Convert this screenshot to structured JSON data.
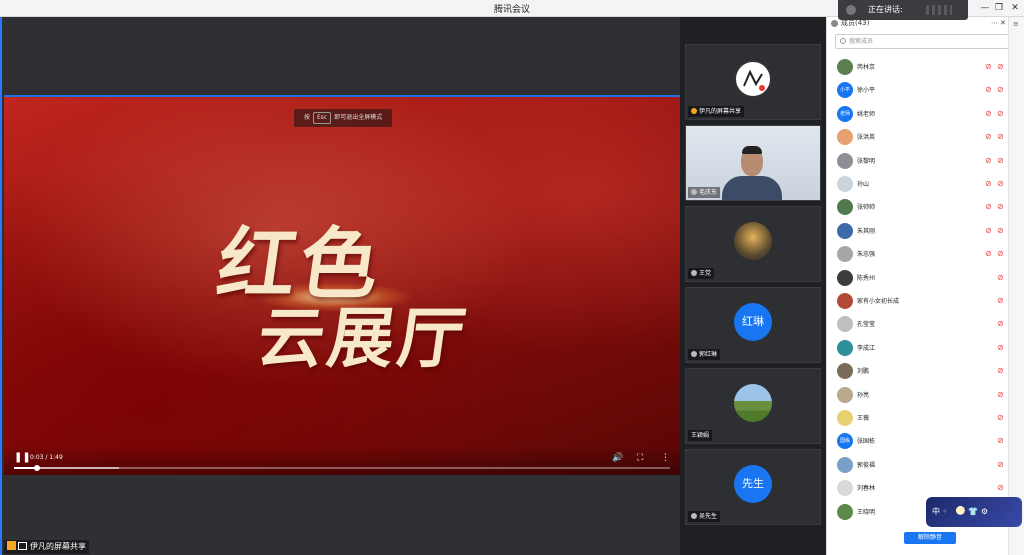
{
  "window": {
    "title": "腾讯会议"
  },
  "speaking": {
    "label": "正在讲话:"
  },
  "video": {
    "title_line1": "红色",
    "title_line2": "云展厅",
    "esc_prefix": "按",
    "esc_key": "Esc",
    "esc_suffix": "即可退出全屏模式",
    "time": "0:03 / 1:49",
    "progress": 0.035,
    "buffered": 0.16
  },
  "share": {
    "label": "伊凡的屏幕共享"
  },
  "tiles": [
    {
      "name": "伊凡的屏幕共享",
      "type": "avatar-logo"
    },
    {
      "name": "毛庆东",
      "type": "camera"
    },
    {
      "name": "王党",
      "type": "avatar-photo"
    },
    {
      "name": "郭红琳",
      "type": "avatar-text",
      "avatar_text": "红琳"
    },
    {
      "name": "王颖娟",
      "type": "avatar-landscape"
    },
    {
      "name": "吴先生",
      "type": "avatar-text",
      "avatar_text": "先生"
    }
  ],
  "members_panel": {
    "title": "成员(43)",
    "search_placeholder": "搜索成员",
    "unmute_all_label": "解除静音",
    "members": [
      {
        "name": "芮林京",
        "avatar_color": "#5b7f4f"
      },
      {
        "name": "徐小平",
        "avatar_color": "#1876f2",
        "avatar_text": "小平"
      },
      {
        "name": "姚老师",
        "avatar_color": "#1876f2",
        "avatar_text": "老师"
      },
      {
        "name": "张洪英",
        "avatar_color": "#e8a070"
      },
      {
        "name": "张黎明",
        "avatar_color": "#8e8e94"
      },
      {
        "name": "孙山",
        "avatar_color": "#c9d4dc"
      },
      {
        "name": "张帅帅",
        "avatar_color": "#507a4e"
      },
      {
        "name": "朱其刚",
        "avatar_color": "#3d6aa8"
      },
      {
        "name": "朱忠强",
        "avatar_color": "#a6a6a6"
      },
      {
        "name": "陈秀州",
        "avatar_color": "#3d3d3d"
      },
      {
        "name": "家有小女初长成",
        "avatar_color": "#b24a3a"
      },
      {
        "name": "孔莹莹",
        "avatar_color": "#bfbfbf"
      },
      {
        "name": "李成江",
        "avatar_color": "#2f8f98"
      },
      {
        "name": "刘鹏",
        "avatar_color": "#7a6a58"
      },
      {
        "name": "孙亮",
        "avatar_color": "#b8a88c"
      },
      {
        "name": "王薇",
        "avatar_color": "#e6d070"
      },
      {
        "name": "张国栋",
        "avatar_color": "#1876f2",
        "avatar_text": "国栋"
      },
      {
        "name": "郭俊福",
        "avatar_color": "#7aa0c8"
      },
      {
        "name": "刘春林",
        "avatar_color": "#d9d9d9"
      },
      {
        "name": "王晓明",
        "avatar_color": "#5d8a4a"
      }
    ]
  },
  "ime": {
    "mode": "中"
  }
}
